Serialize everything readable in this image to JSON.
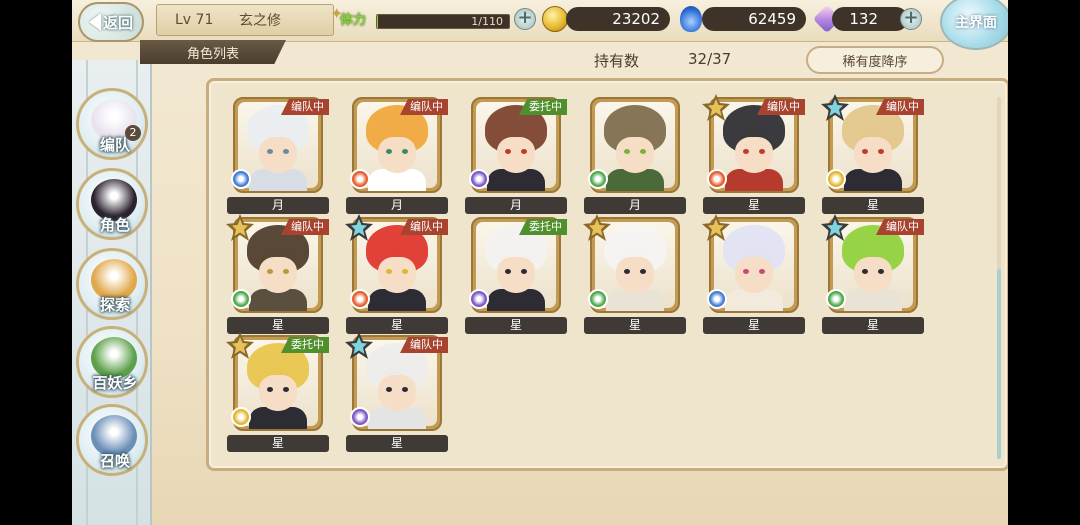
{
  "header": {
    "back_label": "返回",
    "level": "Lv 71",
    "player_name": "玄之修",
    "stamina_label": "体力",
    "stamina_text": "1/110",
    "stamina_fraction": 0.009,
    "gold": "23202",
    "blue_currency": "62459",
    "gems": "132",
    "home_label": "主界面"
  },
  "subbar": {
    "list_tab": "角色列表",
    "owned_label": "持有数",
    "owned_value": "32/37",
    "sort_label": "稀有度降序"
  },
  "nav": [
    {
      "label": "编队",
      "badge": "2",
      "portrait_color": "#e9e3ef"
    },
    {
      "label": "角色",
      "badge": "",
      "portrait_color": "#2b2230"
    },
    {
      "label": "探索",
      "badge": "",
      "portrait_color": "#e0a84a"
    },
    {
      "label": "百妖乡",
      "badge": "",
      "portrait_color": "#5da04a"
    },
    {
      "label": "召唤",
      "badge": "",
      "portrait_color": "#6c8fb8"
    }
  ],
  "cards": [
    {
      "rank": "月",
      "status": "编队中",
      "status_color": "red",
      "star": "",
      "hair": "#e9eef2",
      "element": "#3f7ad6",
      "body": "#d8dde5",
      "eye": "#6b8b9a"
    },
    {
      "rank": "月",
      "status": "编队中",
      "status_color": "red",
      "star": "",
      "hair": "#f0a63a",
      "element": "#e45b2a",
      "body": "#ffffff",
      "eye": "#3f8a66"
    },
    {
      "rank": "月",
      "status": "委托中",
      "status_color": "green",
      "star": "",
      "hair": "#7a3f2a",
      "element": "#7b55c4",
      "body": "#2d2b34",
      "eye": "#c0392b"
    },
    {
      "rank": "月",
      "status": "",
      "status_color": "",
      "star": "",
      "hair": "#7c6a4a",
      "element": "#4aa84a",
      "body": "#4a6a3a",
      "eye": "#7fb03a"
    },
    {
      "rank": "星",
      "status": "编队中",
      "status_color": "red",
      "star": "gold",
      "hair": "#2a2a30",
      "element": "#e45b2a",
      "body": "#b63a2e",
      "eye": "#c0392b"
    },
    {
      "rank": "星",
      "status": "编队中",
      "status_color": "red",
      "star": "blue",
      "hair": "#e2c58a",
      "element": "#e3b52a",
      "body": "#2d2b34",
      "eye": "#c0392b"
    },
    {
      "rank": "星",
      "status": "编队中",
      "status_color": "red",
      "star": "gold",
      "hair": "#4b3a28",
      "element": "#4aa84a",
      "body": "#5b5040",
      "eye": "#b89a3a"
    },
    {
      "rank": "星",
      "status": "编队中",
      "status_color": "red",
      "star": "blue",
      "hair": "#e0322a",
      "element": "#e45b2a",
      "body": "#2d2b34",
      "eye": "#e3b52a"
    },
    {
      "rank": "星",
      "status": "委托中",
      "status_color": "green",
      "star": "",
      "hair": "#f2f2f2",
      "element": "#7b55c4",
      "body": "#2d2b34",
      "eye": "#2d2b34"
    },
    {
      "rank": "星",
      "status": "",
      "status_color": "",
      "star": "gold",
      "hair": "#f4f4f4",
      "element": "#4aa84a",
      "body": "#e9e3d6",
      "eye": "#2d2b34"
    },
    {
      "rank": "星",
      "status": "",
      "status_color": "",
      "star": "gold",
      "hair": "#dfe3f4",
      "element": "#3f7ad6",
      "body": "#f2eadc",
      "eye": "#c7497a"
    },
    {
      "rank": "星",
      "status": "编队中",
      "status_color": "red",
      "star": "blue",
      "hair": "#8ed03a",
      "element": "#4aa84a",
      "body": "#e9e3d6",
      "eye": "#2d2b34"
    },
    {
      "rank": "星",
      "status": "委托中",
      "status_color": "green",
      "star": "gold",
      "hair": "#e8c44a",
      "element": "#e3b52a",
      "body": "#2d2b34",
      "eye": "#2d2b34"
    },
    {
      "rank": "星",
      "status": "编队中",
      "status_color": "red",
      "star": "blue",
      "hair": "#ededed",
      "element": "#7b55c4",
      "body": "#e4e4e4",
      "eye": "#2d2b34"
    }
  ]
}
